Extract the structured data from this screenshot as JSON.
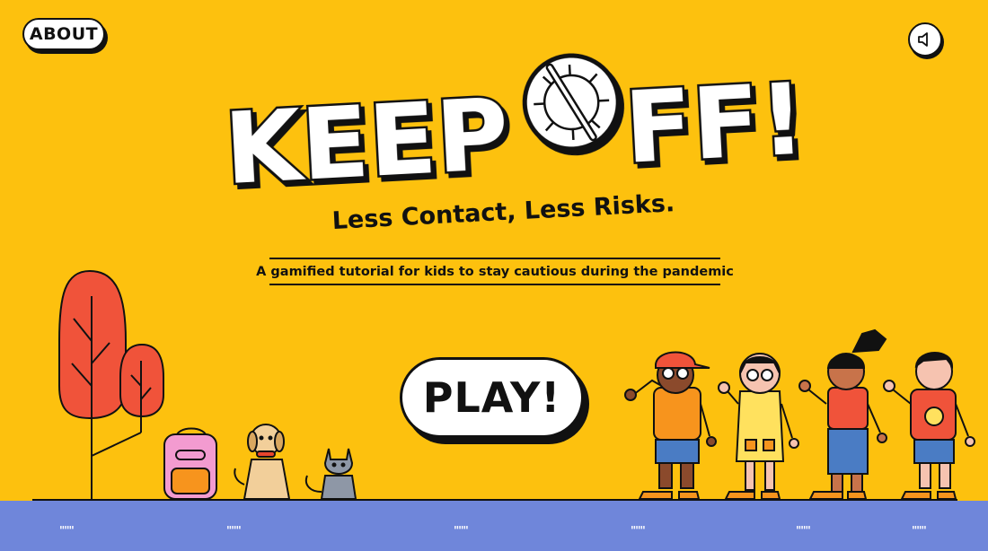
{
  "header": {
    "about_label": "ABOUT",
    "sound_icon": "speaker-icon"
  },
  "title": {
    "line1": "KEEP",
    "line2": "FF!",
    "subtitle": "Less Contact, Less Risks.",
    "tagline": "A gamified tutorial for kids to stay cautious during the pandemic"
  },
  "play": {
    "label": "PLAY!"
  },
  "ground": {
    "ticks": [
      "\"\"\"",
      "\"\"\"",
      "\"\"\"",
      "\"\"\"",
      "\"\"\"",
      "\"\"\""
    ]
  },
  "colors": {
    "background": "#FDC10E",
    "ground": "#6F86DA",
    "tree": "#F0533A",
    "ink": "#111111"
  }
}
